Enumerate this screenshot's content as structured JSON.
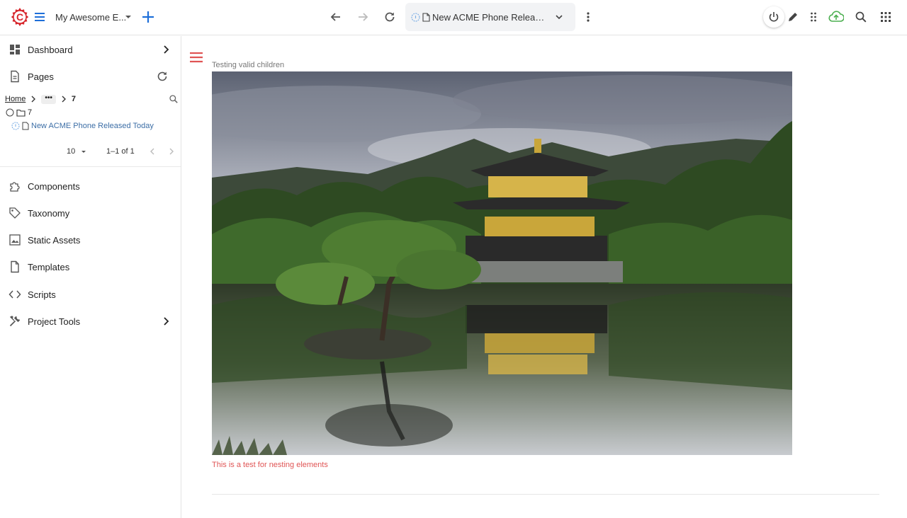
{
  "topbar": {
    "site_name": "My Awesome E...",
    "address_text": "New ACME Phone Released ...",
    "icons": {
      "logo": "crafter-logo-icon",
      "menu": "menu-icon",
      "add": "add-icon",
      "back": "arrow-back-icon",
      "forward": "arrow-forward-icon",
      "reload": "refresh-icon",
      "page_info": "info-icon",
      "page": "page-icon",
      "more": "more-vertical-icon",
      "power": "power-icon",
      "edit": "pencil-icon",
      "drag": "drag-icon",
      "publish": "cloud-upload-icon",
      "search": "search-icon",
      "apps": "apps-grid-icon"
    }
  },
  "sidebar": {
    "dashboard": "Dashboard",
    "pages": "Pages",
    "breadcrumb": {
      "home": "Home",
      "ellipsis": "•••",
      "current": "7"
    },
    "tree": {
      "folder": "7",
      "page": "New ACME Phone Released Today"
    },
    "pager": {
      "rows_per_page": "10",
      "range": "1–1 of 1"
    },
    "items": [
      {
        "label": "Components",
        "icon": "puzzle-icon"
      },
      {
        "label": "Taxonomy",
        "icon": "tag-icon"
      },
      {
        "label": "Static Assets",
        "icon": "image-icon"
      },
      {
        "label": "Templates",
        "icon": "file-icon"
      },
      {
        "label": "Scripts",
        "icon": "code-icon"
      },
      {
        "label": "Project Tools",
        "icon": "tools-icon"
      }
    ]
  },
  "main": {
    "caption_top": "Testing valid children",
    "caption_bottom": "This is a test for nesting elements",
    "image": "Golden pavilion temple reflected in a pond surrounded by pine trees"
  },
  "colors": {
    "brand_red": "#d7262c",
    "accent_blue": "#1e6fd9",
    "link_blue": "#3c6ea6",
    "publish_green": "#4caf50",
    "caption_red": "#e05555"
  }
}
